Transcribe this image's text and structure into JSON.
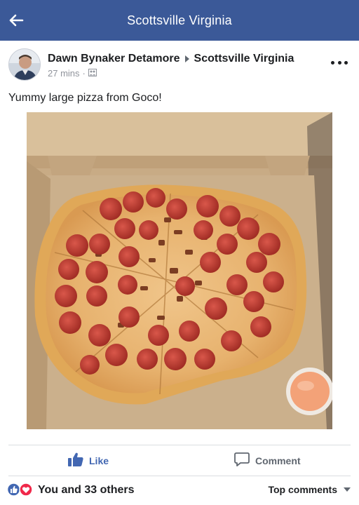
{
  "header": {
    "title": "Scottsville Virginia",
    "back_icon": "back-arrow-icon",
    "background_color": "#3b5998"
  },
  "post": {
    "author": "Dawn Bynaker Detamore",
    "group": "Scottsville Virginia",
    "time": "27 mins",
    "privacy_icon": "group-privacy-icon",
    "text": "Yummy large pizza from Goco!",
    "more_icon": "more-options-icon",
    "photo_icon": "pizza-photo"
  },
  "actions": {
    "like_label": "Like",
    "comment_label": "Comment",
    "like_color": "#4267b2"
  },
  "reactions": {
    "summary": "You and 33 others",
    "sort_label": "Top comments",
    "icons": [
      "like-reaction-icon",
      "love-reaction-icon"
    ]
  }
}
